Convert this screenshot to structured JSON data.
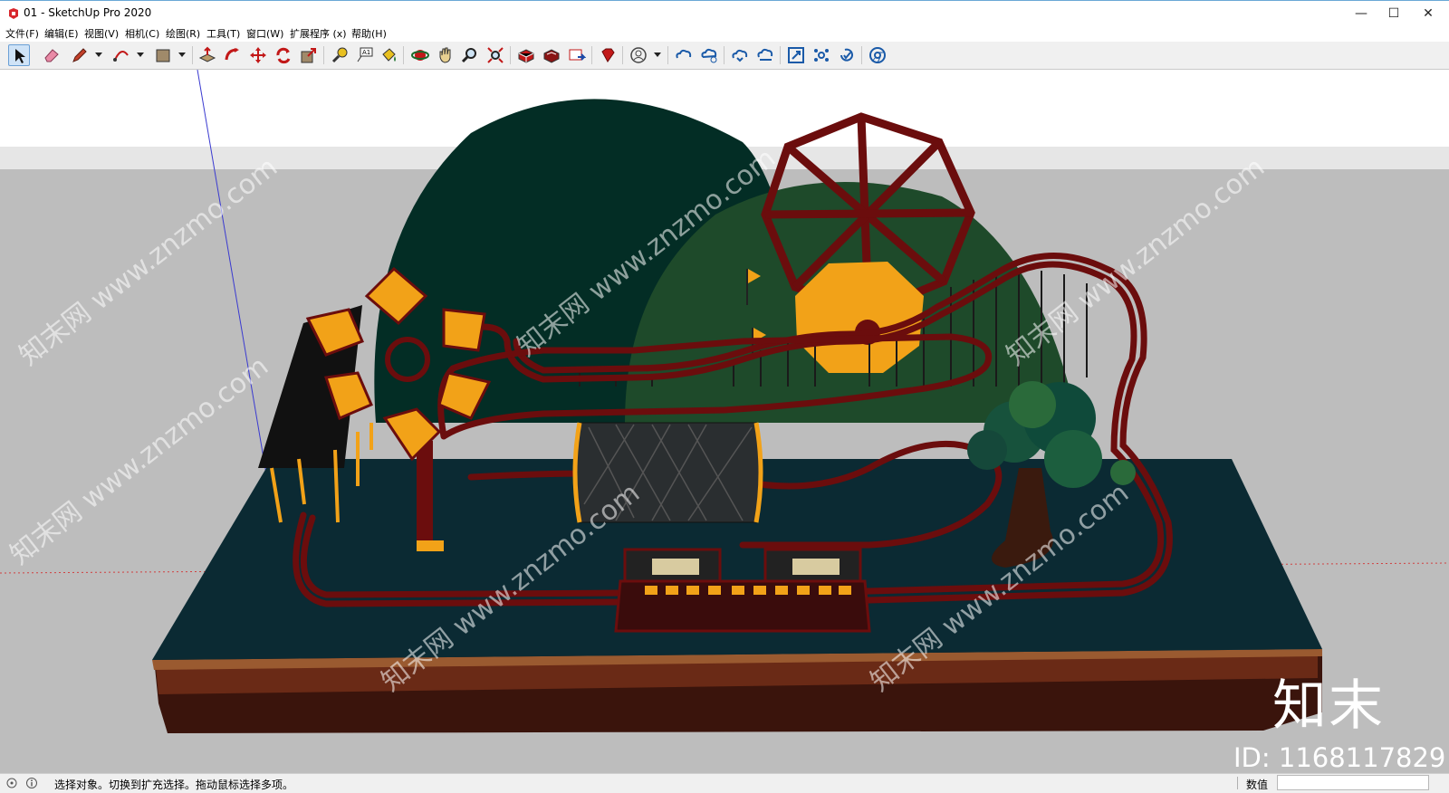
{
  "window": {
    "title": "01 - SketchUp Pro 2020",
    "minimize": "—",
    "maximize": "☐",
    "close": "✕"
  },
  "menu": [
    "文件(F)",
    "编辑(E)",
    "视图(V)",
    "相机(C)",
    "绘图(R)",
    "工具(T)",
    "窗口(W)",
    "扩展程序 (x)",
    "帮助(H)"
  ],
  "toolbar": {
    "tools": [
      "select-icon",
      "eraser-icon",
      "line-pencil-icon",
      "arc-icon",
      "rectangle-icon",
      "push-pull-icon",
      "follow-me-icon",
      "move-icon",
      "rotate-icon",
      "scale-icon",
      "tape-measure-icon",
      "text-icon",
      "paint-bucket-icon",
      "orbit-icon",
      "pan-icon",
      "zoom-icon",
      "zoom-extents-icon",
      "3d-warehouse-icon",
      "extension-warehouse-icon",
      "layout-icon",
      "ruby-icon",
      "user-account-icon",
      "cloud-link-icon",
      "cloud-share-icon",
      "cloud-upload-icon",
      "cloud-stack-icon",
      "window-resize-icon",
      "settings-network-icon",
      "refresh-check-icon",
      "chrome-icon"
    ]
  },
  "viewport": {
    "watermark_text": "知末网 www.znzmo.com",
    "brand_logo": "知末",
    "brand_id": "ID: 1168117829"
  },
  "status": {
    "hint": "选择对象。切换到扩充选择。拖动鼠标选择多项。",
    "measurements_label": "数值",
    "measurements_value": ""
  },
  "colors": {
    "sky_top": "#ffffff",
    "ground_gray": "#b8b8b8",
    "base_top": "#0b2a33",
    "base_side_wood": "#5a2a18",
    "track_red": "#6b0d0d",
    "accent_orange": "#f2a218",
    "hill_dark": "#032d25",
    "hill_green": "#1e4a2a"
  }
}
